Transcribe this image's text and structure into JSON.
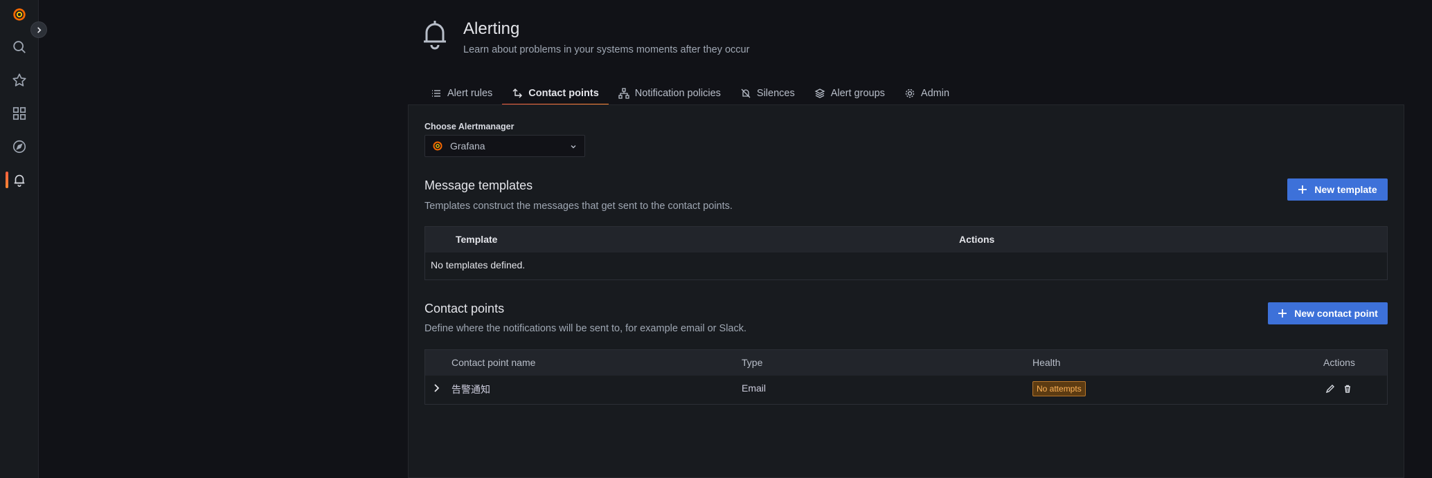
{
  "sidebar": {
    "items": [
      {
        "icon": "grafana-logo-icon"
      },
      {
        "icon": "search-icon"
      },
      {
        "icon": "star-icon"
      },
      {
        "icon": "dashboards-icon"
      },
      {
        "icon": "explore-compass-icon"
      },
      {
        "icon": "alerting-bell-icon",
        "active": true
      }
    ],
    "expand_icon": "chevron-right-icon"
  },
  "header": {
    "icon": "bell-icon",
    "title": "Alerting",
    "subtitle": "Learn about problems in your systems moments after they occur"
  },
  "tabs": [
    {
      "label": "Alert rules",
      "icon": "list-icon"
    },
    {
      "label": "Contact points",
      "icon": "contact-points-icon",
      "active": true
    },
    {
      "label": "Notification policies",
      "icon": "sitemap-icon"
    },
    {
      "label": "Silences",
      "icon": "bell-slash-icon"
    },
    {
      "label": "Alert groups",
      "icon": "layer-group-icon"
    },
    {
      "label": "Admin",
      "icon": "cog-icon"
    }
  ],
  "alertmanager": {
    "label": "Choose Alertmanager",
    "selected": "Grafana"
  },
  "templates": {
    "title": "Message templates",
    "description": "Templates construct the messages that get sent to the contact points.",
    "new_button": "New template",
    "columns": [
      "Template",
      "Actions"
    ],
    "empty_text": "No templates defined."
  },
  "contact_points": {
    "title": "Contact points",
    "description": "Define where the notifications will be sent to, for example email or Slack.",
    "new_button": "New contact point",
    "columns": [
      "Contact point name",
      "Type",
      "Health",
      "Actions"
    ],
    "rows": [
      {
        "name": "告警通知",
        "type": "Email",
        "health": "No attempts"
      }
    ]
  },
  "colors": {
    "accent": "#f55f3e",
    "primary_button": "#3d71d9",
    "badge_text": "#ffb357"
  }
}
